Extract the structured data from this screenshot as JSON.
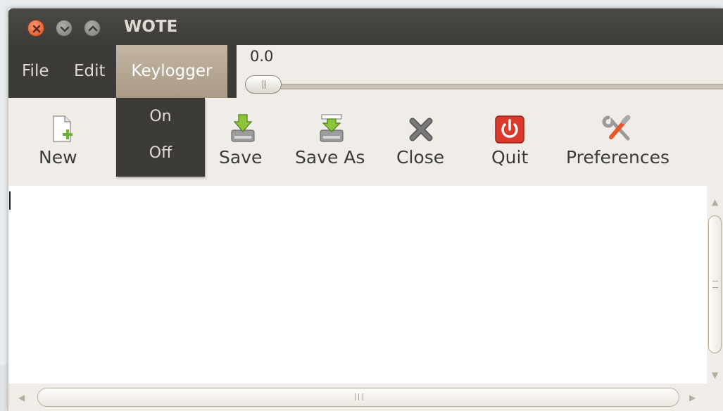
{
  "window": {
    "title": "WOTE"
  },
  "menubar": {
    "file": "File",
    "edit": "Edit",
    "keylogger": "Keylogger"
  },
  "keylogger_menu": {
    "on": "On",
    "off": "Off"
  },
  "slider": {
    "value_text": "0.0",
    "value": 0.0
  },
  "toolbar": {
    "new": "New",
    "save": "Save",
    "save_as": "Save As",
    "close": "Close",
    "quit": "Quit",
    "preferences": "Preferences"
  },
  "editor": {
    "content": ""
  },
  "colors": {
    "titlebar": "#3c3b37",
    "menu_highlight": "#a99a85",
    "window_bg": "#f0ede8",
    "quit_red": "#d93a2b",
    "save_green": "#8cc43a"
  }
}
